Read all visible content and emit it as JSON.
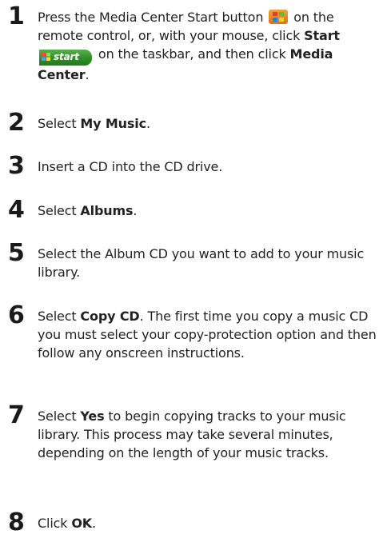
{
  "steps": [
    {
      "number": "1"
    },
    {
      "number": "2",
      "text_before": "Select ",
      "bold": "My Music",
      "text_after": "."
    },
    {
      "number": "3",
      "text": "Insert a CD into the CD drive."
    },
    {
      "number": "4",
      "text_before": "Select ",
      "bold": "Albums",
      "text_after": "."
    },
    {
      "number": "5",
      "text": "Select the Album CD you want to add to your music library."
    },
    {
      "number": "6",
      "text_before": "Select ",
      "bold": "Copy CD",
      "text_after": ". The first time you copy a music CD you must select your copy-protection option and then follow any onscreen instructions."
    },
    {
      "number": "7",
      "text_before": "Select ",
      "bold": "Yes",
      "text_after": " to begin copying tracks to your music library. This process may take several minutes, depending on the length of your music tracks."
    },
    {
      "number": "8",
      "text_before": "Click ",
      "bold": "OK",
      "text_after": "."
    }
  ],
  "step1": {
    "part1": "Press the Media Center Start button",
    "part2": " on the remote control, or, with your mouse, click ",
    "start_bold": "Start",
    "start_button_label": "start",
    "part3": " on the taskbar, and then click ",
    "media_center_bold": "Media Center",
    "part4": "."
  },
  "icons": {
    "media_center_button": "windows-logo-icon",
    "start_button": "windows-start-button-icon"
  },
  "colors": {
    "start_button_green": "#2f8a27",
    "logo_orange": "#e8861f"
  }
}
